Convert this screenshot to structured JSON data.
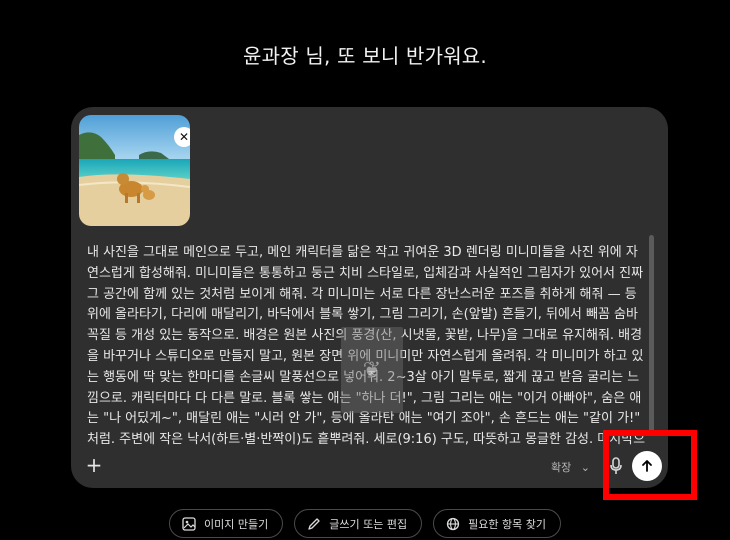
{
  "greeting": "윤과장 님, 또 보니 반가워요.",
  "attachment": {
    "alt": "beach photo with two dogs",
    "close_icon": "close-icon"
  },
  "prompt_text": "내 사진을 그대로 메인으로 두고, 메인 캐릭터를 닮은 작고 귀여운 3D 렌더링 미니미들을 사진 위에 자연스럽게 합성해줘. 미니미들은 통통하고 둥근 치비 스타일로, 입체감과 사실적인 그림자가 있어서 진짜 그 공간에 함께 있는 것처럼 보이게 해줘. 각 미니미는 서로 다른 장난스러운 포즈를 취하게 해줘 — 등 위에 올라타기, 다리에 매달리기, 바닥에서 블록 쌓기, 그림 그리기, 손(앞발) 흔들기, 뒤에서 빼꼼 숨바꼭질 등 개성 있는 동작으로. 배경은 원본 사진의 풍경(산, 시냇물, 꽃밭, 나무)을 그대로 유지해줘. 배경을 바꾸거나 스튜디오로 만들지 말고, 원본 장면 위에 미니미만 자연스럽게 올려줘. 각 미니미가 하고 있는 행동에 딱 맞는 한마디를 손글씨 말풍선으로 넣어줘. 2~3살 아기 말투로, 짧게 끊고 받음 굴리는 느낌으로. 캐릭터마다 다 다른 말로. 블록 쌓는 애는 \"하나 더!\", 그림 그리는 애는 \"이거 아빠야\", 숨은 애는 \"나 어딨게~\", 매달린 애는 \"시러 안 가\", 등에 올라탄 애는 \"여기 조아\", 손 흔드는 애는 \"같이 가!\" 처럼. 주변에 작은 낙서(하트·별·반짝이)도 흩뿌려줘. 세로(9:16) 구도, 따뜻하고 몽글한 감성. 마지막으로 하단에 짧은 한국어 감성 제목 한 줄.",
  "toolbar": {
    "add_icon": "plus-icon",
    "expand_label": "확장",
    "mic_icon": "microphone-icon",
    "send_icon": "arrow-up-icon"
  },
  "chips": [
    {
      "label": "이미지 만들기",
      "icon": "image-icon"
    },
    {
      "label": "글쓰기 또는 편집",
      "icon": "pen-icon"
    },
    {
      "label": "필요한 항목 찾기",
      "icon": "globe-icon"
    }
  ]
}
